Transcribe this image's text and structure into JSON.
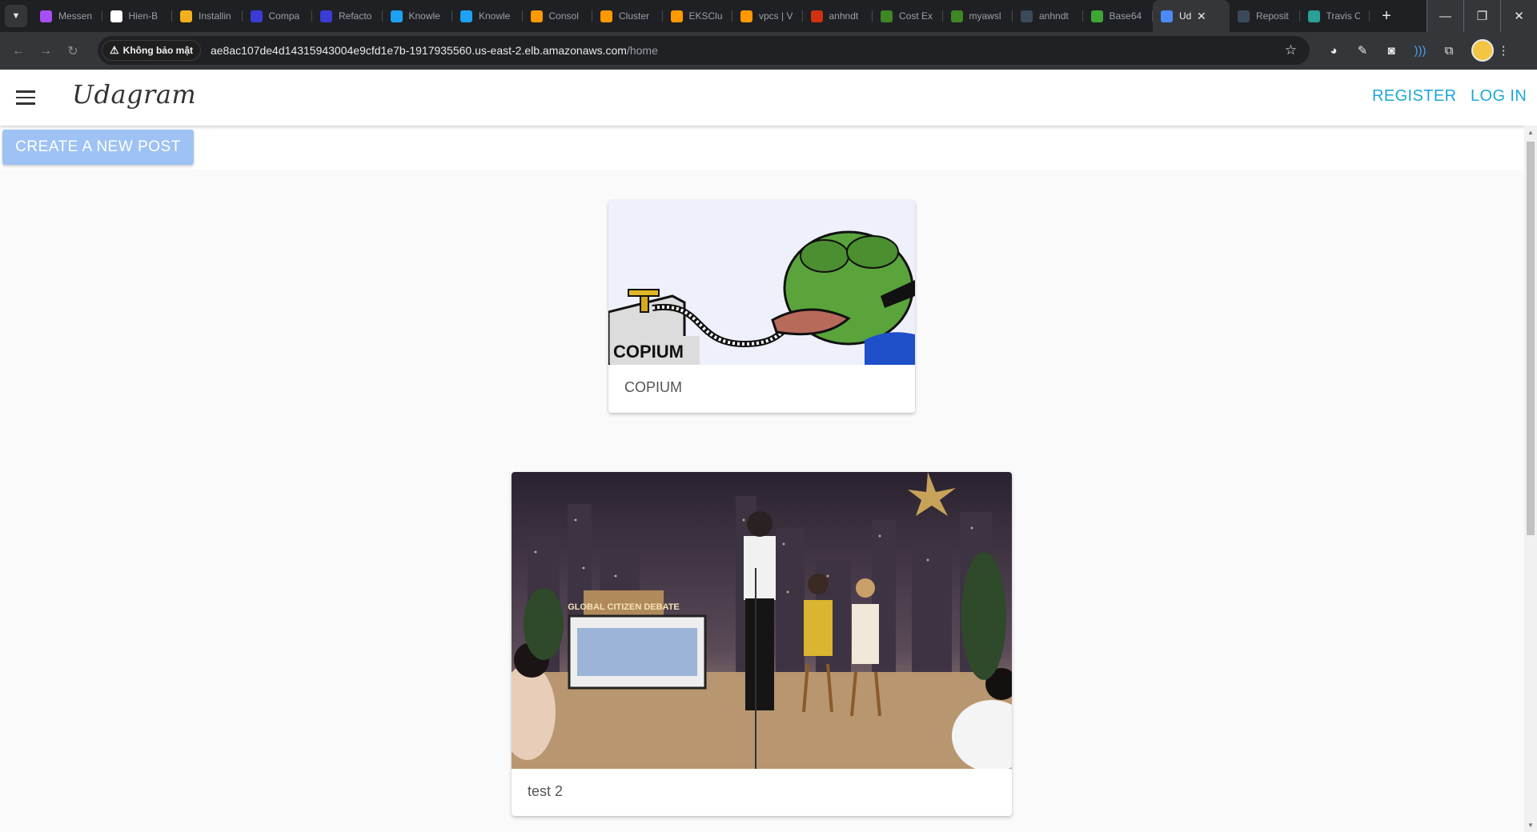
{
  "browser": {
    "tabs": [
      {
        "label": "Messen",
        "icon": "messenger-icon",
        "color": "#a64ff5"
      },
      {
        "label": "Hien-B",
        "icon": "github-icon",
        "color": "#ffffff"
      },
      {
        "label": "Installin",
        "icon": "box-icon",
        "color": "#f2b01e"
      },
      {
        "label": "Compa",
        "icon": "udacity-icon",
        "color": "#3b3bd6"
      },
      {
        "label": "Refacto",
        "icon": "udacity-icon",
        "color": "#3b3bd6"
      },
      {
        "label": "Knowle",
        "icon": "udacity-icon",
        "color": "#1da1f2"
      },
      {
        "label": "Knowle",
        "icon": "udacity-icon",
        "color": "#1da1f2"
      },
      {
        "label": "Consol",
        "icon": "aws-icon",
        "color": "#ff9900"
      },
      {
        "label": "Cluster",
        "icon": "aws-icon",
        "color": "#ff9900"
      },
      {
        "label": "EKSClu",
        "icon": "aws-icon",
        "color": "#ff9900"
      },
      {
        "label": "vpcs | V",
        "icon": "aws-icon",
        "color": "#ff9900"
      },
      {
        "label": "anhndt",
        "icon": "aws-icon",
        "color": "#d13212"
      },
      {
        "label": "Cost Ex",
        "icon": "aws-icon",
        "color": "#3f8624"
      },
      {
        "label": "myawsl",
        "icon": "aws-icon",
        "color": "#3f8624"
      },
      {
        "label": "anhndt",
        "icon": "aws-icon",
        "color": "#3b4a5a"
      },
      {
        "label": "Base64",
        "icon": "b64-icon",
        "color": "#3fa535"
      },
      {
        "label": "Ud",
        "icon": "app-icon",
        "color": "#4c8bf5",
        "active": true
      },
      {
        "label": "Reposit",
        "icon": "aws-icon",
        "color": "#3b4a5a"
      },
      {
        "label": "Travis C",
        "icon": "travis-icon",
        "color": "#2aa198"
      }
    ],
    "security_label": "Không bảo mật",
    "url_host": "ae8ac107de4d14315943004e9cfd1e7b-1917935560.us-east-2.elb.amazonaws.com",
    "url_path": "/home"
  },
  "app": {
    "brand": "Udagram",
    "register_label": "REGISTER",
    "login_label": "LOG IN",
    "create_post_label": "CREATE A NEW POST"
  },
  "feed": {
    "posts": [
      {
        "caption": "COPIUM",
        "image_text": "COPIUM"
      },
      {
        "caption": "test 2",
        "image_text": "GLOBAL CITIZEN DEBATE"
      }
    ]
  }
}
